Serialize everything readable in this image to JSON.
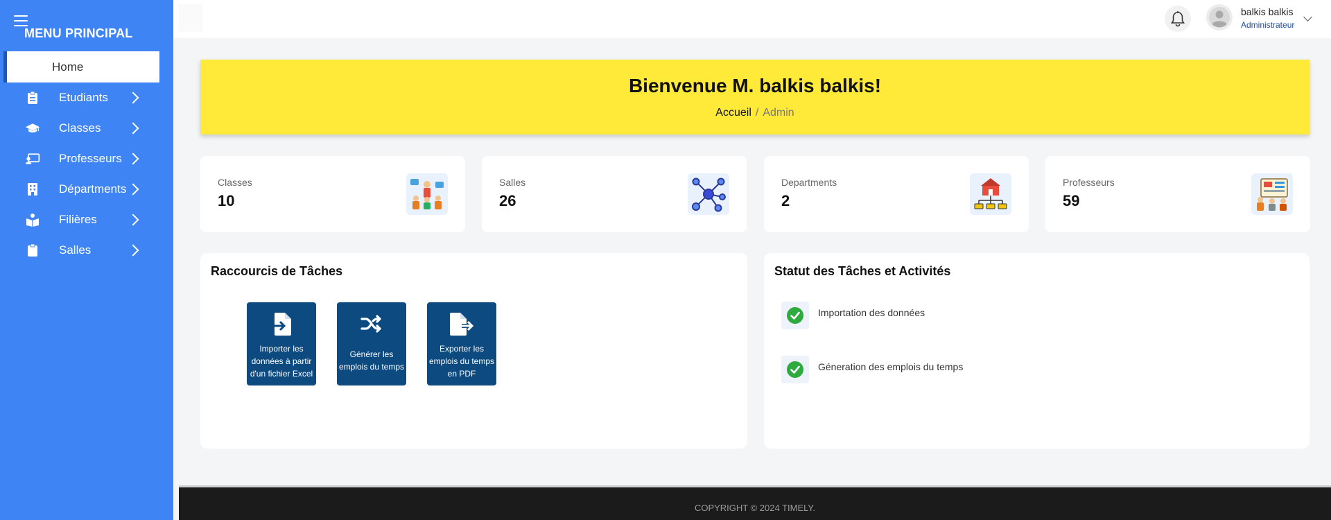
{
  "sidebar": {
    "title": "MENU PRINCIPAL",
    "home_label": "Home",
    "items": [
      {
        "label": "Etudiants",
        "icon": "clipboard-icon"
      },
      {
        "label": "Classes",
        "icon": "graduation-cap-icon"
      },
      {
        "label": "Professeurs",
        "icon": "chalkboard-teacher-icon"
      },
      {
        "label": "Départments",
        "icon": "building-icon"
      },
      {
        "label": "Filières",
        "icon": "users-book-icon"
      },
      {
        "label": "Salles",
        "icon": "clipboard-check-icon"
      }
    ]
  },
  "header": {
    "user_name": "balkis balkis",
    "user_role": "Administrateur"
  },
  "banner": {
    "title": "Bienvenue M. balkis balkis!",
    "breadcrumb_home": "Accueil",
    "breadcrumb_sep": "/",
    "breadcrumb_current": "Admin"
  },
  "stats": [
    {
      "label": "Classes",
      "value": "10",
      "icon": "classroom-icon"
    },
    {
      "label": "Salles",
      "value": "26",
      "icon": "network-icon"
    },
    {
      "label": "Departments",
      "value": "2",
      "icon": "department-icon"
    },
    {
      "label": "Professeurs",
      "value": "59",
      "icon": "teacher-board-icon"
    }
  ],
  "shortcuts": {
    "title": "Raccourcis de Tâches",
    "buttons": [
      {
        "label": "Importer les données à partir d'un fichier Excel",
        "icon": "file-import-icon"
      },
      {
        "label": "Générer les emplois du temps",
        "icon": "shuffle-icon"
      },
      {
        "label": "Exporter les emplois du temps en PDF",
        "icon": "file-export-icon"
      }
    ]
  },
  "activities": {
    "title": "Statut des Tâches et Activités",
    "items": [
      {
        "label": "Importation des données",
        "status": "done"
      },
      {
        "label": "Géneration des emplois du temps",
        "status": "done"
      }
    ]
  },
  "footer": {
    "text": "COPYRIGHT © 2024 TIMELY."
  },
  "colors": {
    "sidebar": "#3e84f4",
    "banner": "#ffea3a",
    "shortcut_button": "#0d4a80",
    "check": "#2eaa3f",
    "footer": "#1b1b1b"
  }
}
